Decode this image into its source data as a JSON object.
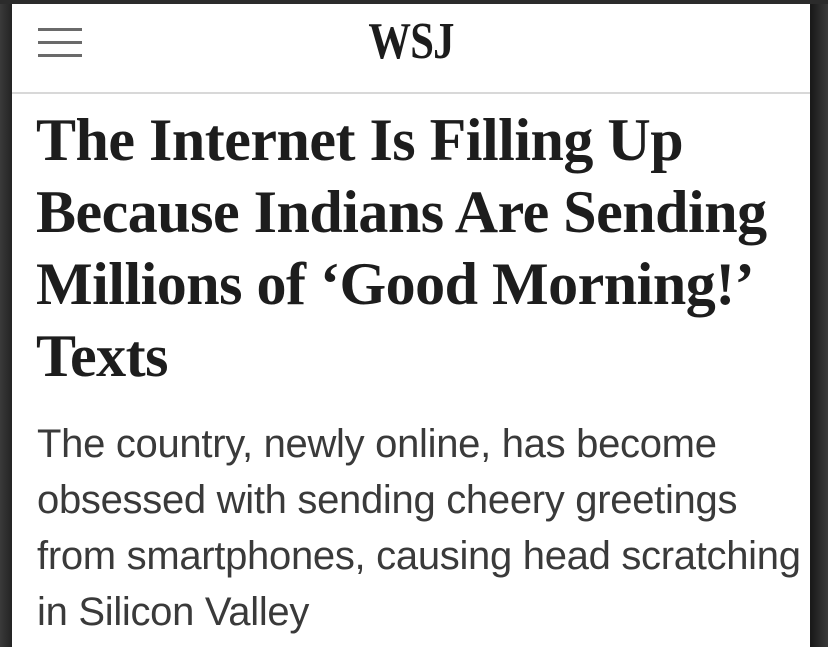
{
  "header": {
    "logo_text": "WSJ",
    "menu_icon": "hamburger-menu-icon"
  },
  "article": {
    "headline": "The Internet Is Filling Up Because Indians Are Sending Millions of ‘Good Morning!’ Texts",
    "dek": "The country, newly online, has become obsessed with sending cheery greetings from smartphones, causing head scratching in Silicon Valley"
  },
  "colors": {
    "background": "#ffffff",
    "headline": "#1d1d1d",
    "dek": "#3a3a3a",
    "divider": "#d8d8d8"
  }
}
